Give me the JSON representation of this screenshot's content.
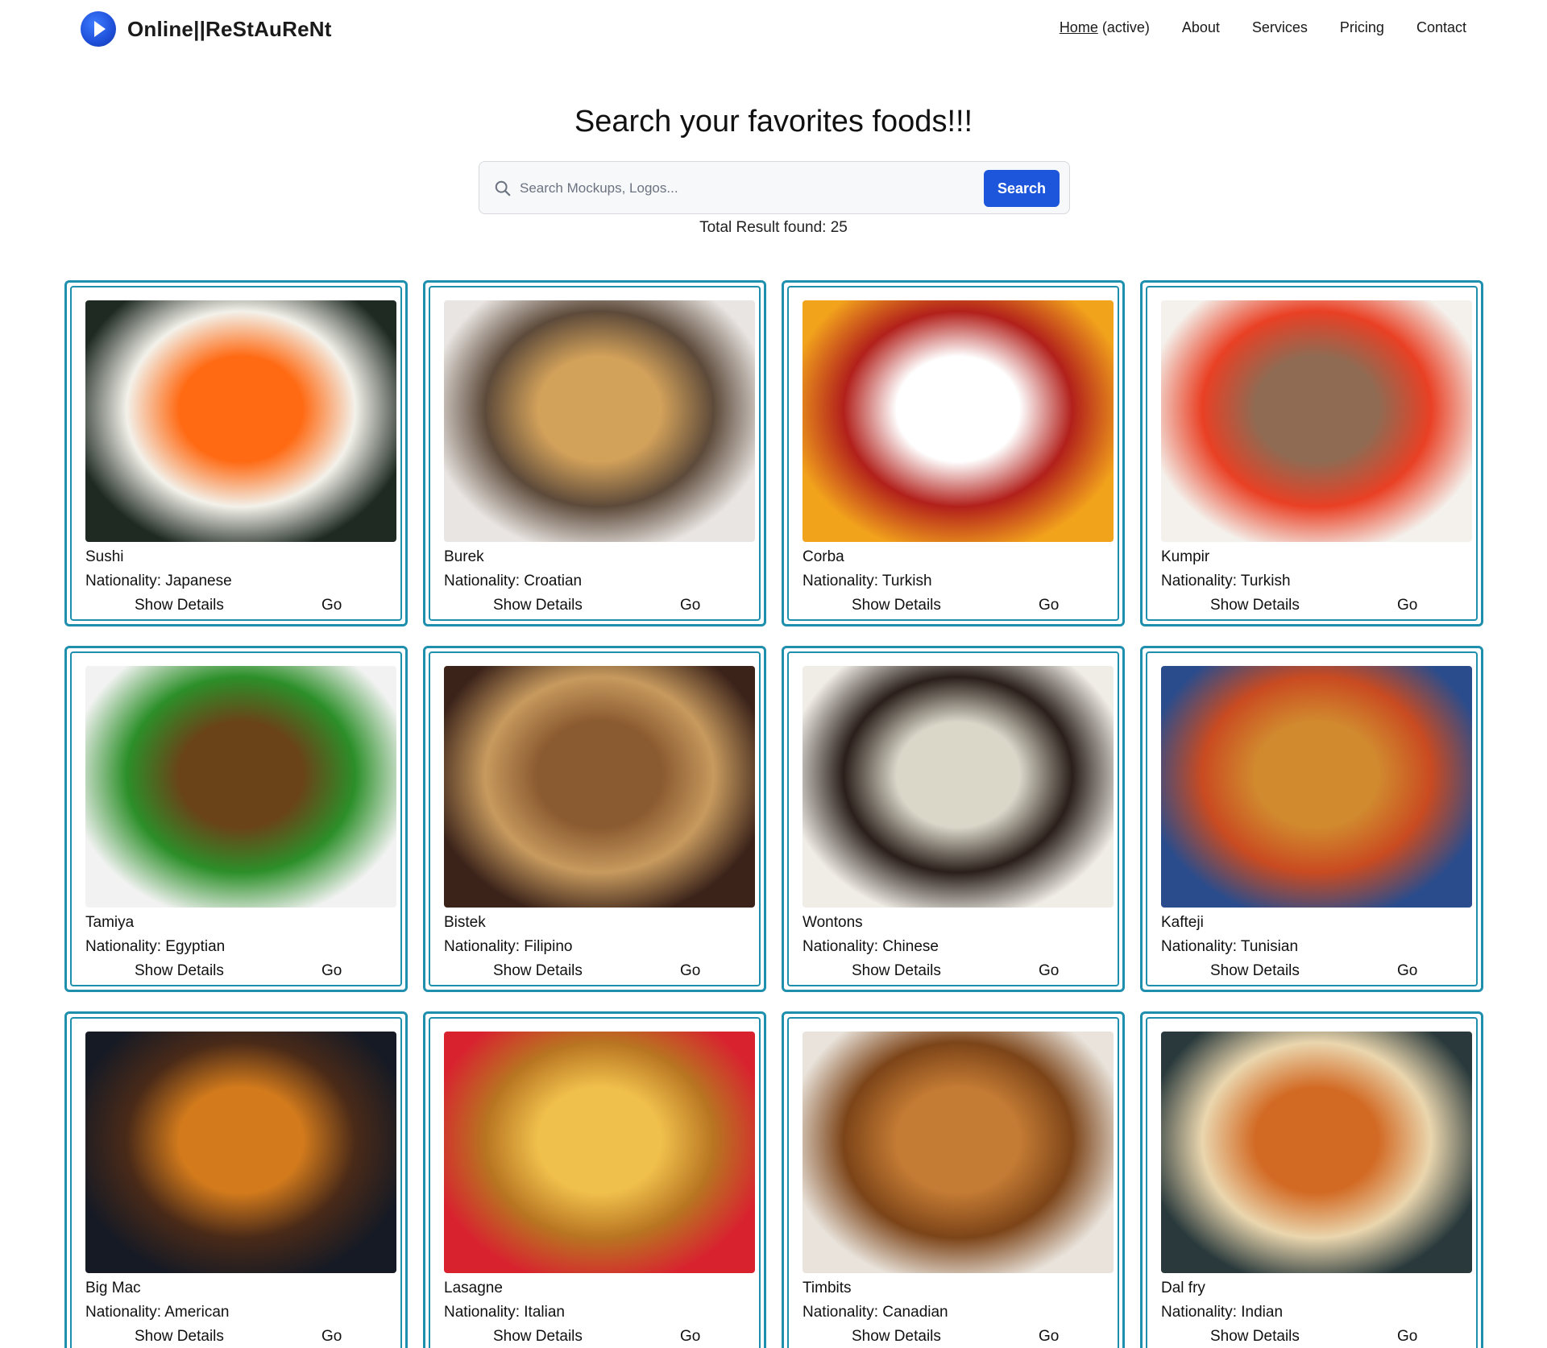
{
  "brand": {
    "name": "Online||ReStAuReNt"
  },
  "nav": {
    "home": "Home",
    "home_suffix": " (active)",
    "about": "About",
    "services": "Services",
    "pricing": "Pricing",
    "contact": "Contact"
  },
  "hero": {
    "title": "Search your favorites foods!!!"
  },
  "search": {
    "placeholder": "Search Mockups, Logos...",
    "button": "Search"
  },
  "results": {
    "total": "Total Result found: 25"
  },
  "labels": {
    "details": "Show Details",
    "go": "Go"
  },
  "foods": [
    {
      "name": "Sushi",
      "nationality": "Nationality: Japanese",
      "colors": [
        "#1e2a22",
        "#ff6a13",
        "#f3f1ea"
      ]
    },
    {
      "name": "Burek",
      "nationality": "Nationality: Croatian",
      "colors": [
        "#e9e5e2",
        "#d2a15a",
        "#5d4a3a"
      ]
    },
    {
      "name": "Corba",
      "nationality": "Nationality: Turkish",
      "colors": [
        "#f2a31c",
        "#ffffff",
        "#b2201b"
      ]
    },
    {
      "name": "Kumpir",
      "nationality": "Nationality: Turkish",
      "colors": [
        "#f4f1ec",
        "#8f6b53",
        "#e94024"
      ]
    },
    {
      "name": "Tamiya",
      "nationality": "Nationality: Egyptian",
      "colors": [
        "#f1f2f1",
        "#6a4318",
        "#2c8f29"
      ]
    },
    {
      "name": "Bistek",
      "nationality": "Nationality: Filipino",
      "colors": [
        "#3b231a",
        "#8a5a30",
        "#c79a5e"
      ]
    },
    {
      "name": "Wontons",
      "nationality": "Nationality: Chinese",
      "colors": [
        "#f0ede6",
        "#dad7c9",
        "#2a1f1a"
      ]
    },
    {
      "name": "Kafteji",
      "nationality": "Nationality: Tunisian",
      "colors": [
        "#2a4c8c",
        "#d18a2e",
        "#c94b21"
      ]
    },
    {
      "name": "Big Mac",
      "nationality": "Nationality: American",
      "colors": [
        "#161a24",
        "#d37b1c",
        "#4a2a18"
      ]
    },
    {
      "name": "Lasagne",
      "nationality": "Nationality: Italian",
      "colors": [
        "#d8232f",
        "#f0c04c",
        "#b87521"
      ]
    },
    {
      "name": "Timbits",
      "nationality": "Nationality: Canadian",
      "colors": [
        "#e9e3db",
        "#c47b34",
        "#7c4418"
      ]
    },
    {
      "name": "Dal fry",
      "nationality": "Nationality: Indian",
      "colors": [
        "#2a3a3c",
        "#d26a24",
        "#ead6ae"
      ]
    }
  ]
}
